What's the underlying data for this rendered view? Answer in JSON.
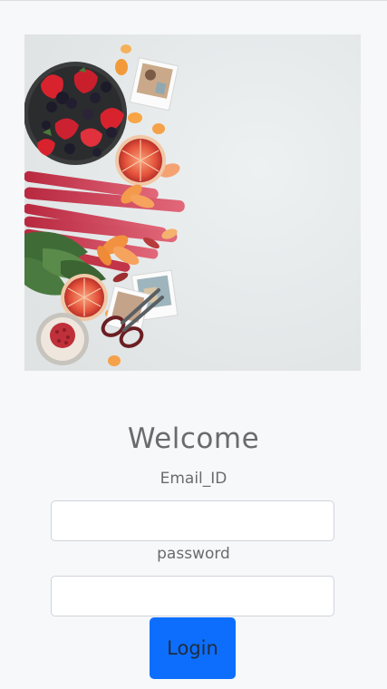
{
  "header": {
    "title": "Welcome"
  },
  "form": {
    "email_label": "Email_ID",
    "email_value": "",
    "password_label": "password",
    "password_value": "",
    "login_label": "Login"
  },
  "colors": {
    "background": "#f7f8fa",
    "primary_button": "#0d6efd",
    "text": "#6b6b6b"
  }
}
